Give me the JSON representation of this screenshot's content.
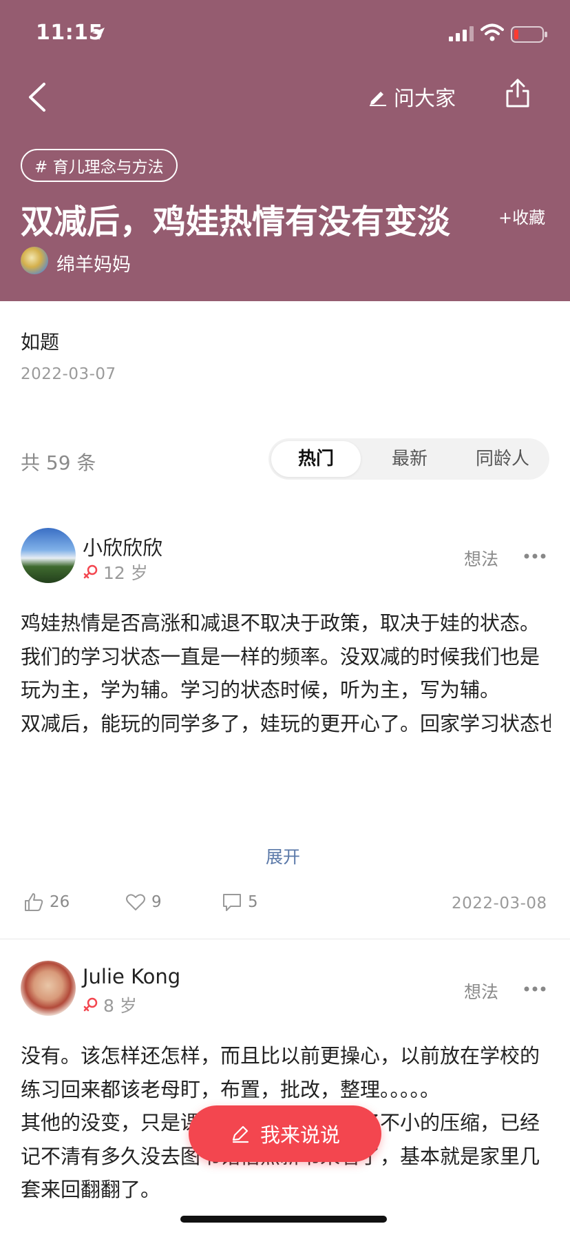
{
  "status_bar": {
    "time": "11:15"
  },
  "header": {
    "ask_label": "问大家",
    "topic_tag": "# 育儿理念与方法",
    "title": "双减后，鸡娃热情有没有变淡",
    "favorite_label": "+收藏",
    "author_name": "绵羊妈妈"
  },
  "question": {
    "body": "如题",
    "date": "2022-03-07"
  },
  "answers_bar": {
    "total": "共 59 条",
    "tabs": [
      "热门",
      "最新",
      "同龄人"
    ],
    "active_tab": "热门"
  },
  "posts": [
    {
      "username": "小欣欣欣",
      "age": "12 岁",
      "type": "想法",
      "paragraphs": [
        "鸡娃热情是否高涨和减退不取决于政策，取决于娃的状态。",
        "我们的学习状态一直是一样的频率。没双减的时候我们也是玩为主，学为辅。学习的状态时候，听为主，写为辅。",
        "双减后，能玩的同学多了，娃玩的更开心了。回家学习状态也比较好，毕竟玩够了，玩开心了，没啥理…"
      ],
      "expand_label": "展开",
      "likes": "26",
      "hearts": "9",
      "comments": "5",
      "date": "2022-03-08"
    },
    {
      "username": "Julie Kong",
      "age": "8 岁",
      "type": "想法",
      "paragraphs": [
        "没有。该怎样还怎样，而且比以前更操心，以前放在学校的练习回来都该老母盯，布置，批改，整理。。。。。",
        "其他的没变，只是课外阅读量还是受到了不小的压缩，已经记不清有多久没去图书馆借点新书来看了，基本就是家里几套来回翻翻了。"
      ]
    }
  ],
  "fab": {
    "label": "我来说说"
  },
  "colors": {
    "header_bg": "#955c70",
    "accent": "#f3464f",
    "link": "#5a78a8"
  }
}
